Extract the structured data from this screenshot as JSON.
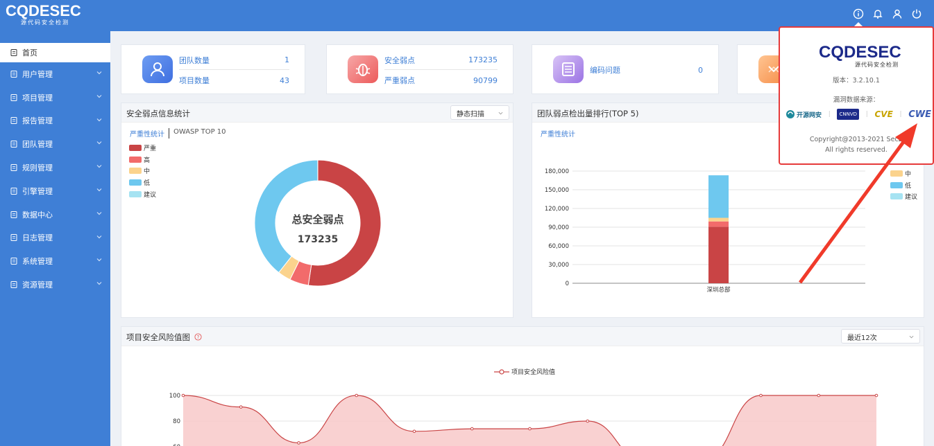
{
  "brand": {
    "name": "CQDESEC",
    "tagline": "源代码安全检测"
  },
  "topbar": {
    "icons": [
      "info-icon",
      "bell-icon",
      "user-icon",
      "power-icon"
    ]
  },
  "sidebar": {
    "items": [
      {
        "label": "首页",
        "icon": "home-icon",
        "active": true
      },
      {
        "label": "用户管理",
        "icon": "user-manage-icon"
      },
      {
        "label": "项目管理",
        "icon": "project-icon"
      },
      {
        "label": "报告管理",
        "icon": "report-icon"
      },
      {
        "label": "团队管理",
        "icon": "team-icon"
      },
      {
        "label": "规则管理",
        "icon": "rule-icon"
      },
      {
        "label": "引擎管理",
        "icon": "engine-icon"
      },
      {
        "label": "数据中心",
        "icon": "data-center-icon"
      },
      {
        "label": "日志管理",
        "icon": "log-icon"
      },
      {
        "label": "系统管理",
        "icon": "system-icon"
      },
      {
        "label": "资源管理",
        "icon": "resource-icon"
      }
    ]
  },
  "stats": {
    "team": {
      "label1": "团队数量",
      "value1": "1",
      "label2": "项目数量",
      "value2": "43"
    },
    "vuln": {
      "label1": "安全弱点",
      "value1": "173235",
      "label2": "严重弱点",
      "value2": "90799"
    },
    "coding": {
      "label1": "编码问题",
      "value1": "0"
    }
  },
  "vuln_panel": {
    "title": "安全弱点信息统计",
    "select": "静态扫描",
    "tabs": [
      "严重性统计",
      "OWASP TOP 10"
    ],
    "legend": [
      {
        "name": "严重",
        "color": "#c94445"
      },
      {
        "name": "高",
        "color": "#f26b6b"
      },
      {
        "name": "中",
        "color": "#fbd38d"
      },
      {
        "name": "低",
        "color": "#6ec8ef"
      },
      {
        "name": "建议",
        "color": "#a6e3f2"
      }
    ],
    "center_title": "总安全弱点",
    "center_value": "173235"
  },
  "team_panel": {
    "title": "团队弱点检出量排行(TOP 5)",
    "tab": "严重性统计",
    "legend": [
      "中",
      "低",
      "建议"
    ]
  },
  "risk_panel": {
    "title": "项目安全风险值图",
    "select": "最近12次",
    "legend": "项目安全风险值"
  },
  "popup": {
    "logo": "CQDESEC",
    "logo_sub": "源代码安全检测",
    "version": "版本：3.2.10.1",
    "source_label": "漏洞数据来源：",
    "sources": [
      "开源网安",
      "CNNVD",
      "CVE",
      "CWE"
    ],
    "copyright": "Copyright@2013-2021 SecZ",
    "rights": "All rights reserved."
  },
  "chart_data": [
    {
      "type": "pie",
      "title": "总安全弱点",
      "labels": [
        "严重",
        "高",
        "中",
        "低",
        "建议"
      ],
      "values": [
        90799,
        8400,
        5800,
        68200,
        36
      ],
      "colors": [
        "#c94445",
        "#f26b6b",
        "#fbd38d",
        "#6ec8ef",
        "#a6e3f2"
      ]
    },
    {
      "type": "bar",
      "stacked": true,
      "categories": [
        "深圳总部"
      ],
      "ylim": [
        0,
        180000
      ],
      "yticks": [
        "0",
        "30,000",
        "60,000",
        "90,000",
        "120,000",
        "150,000",
        "180,000"
      ],
      "series": [
        {
          "name": "严重",
          "values": [
            90799
          ],
          "color": "#c94445"
        },
        {
          "name": "高",
          "values": [
            8400
          ],
          "color": "#f26b6b"
        },
        {
          "name": "中",
          "values": [
            5800
          ],
          "color": "#fbd38d"
        },
        {
          "name": "低",
          "values": [
            68200
          ],
          "color": "#6ec8ef"
        },
        {
          "name": "建议",
          "values": [
            36
          ],
          "color": "#a6e3f2"
        }
      ]
    },
    {
      "type": "area",
      "series": [
        {
          "name": "项目安全风险值",
          "values": [
            100,
            91,
            63,
            100,
            72,
            74,
            74,
            80,
            49,
            50,
            100,
            100,
            100
          ]
        }
      ],
      "yticks": [
        "100",
        "80",
        "60"
      ],
      "ylim": [
        40,
        100
      ],
      "color": "#c94445"
    }
  ]
}
